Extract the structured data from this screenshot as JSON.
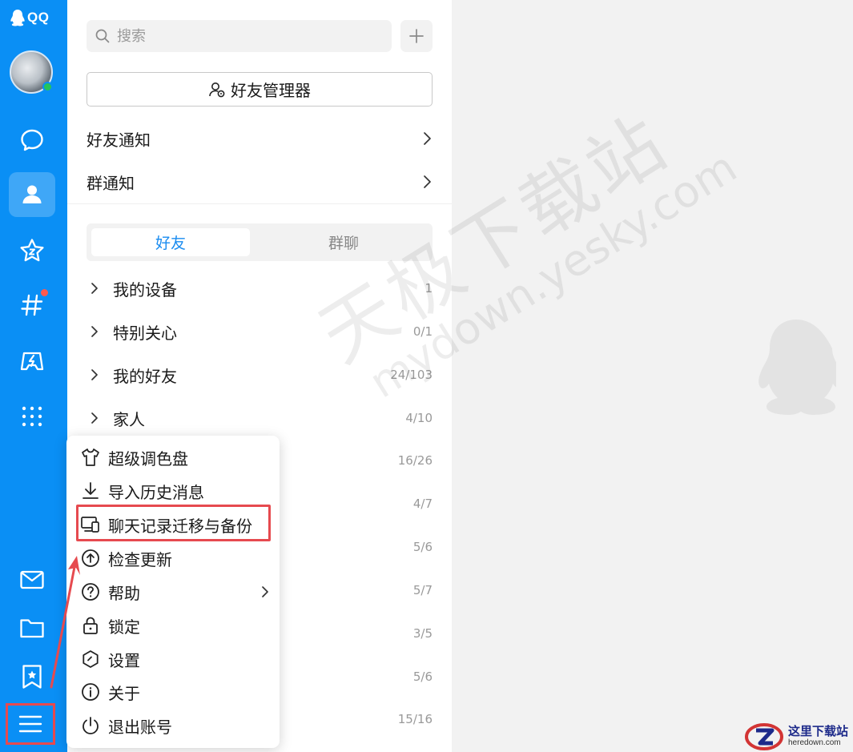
{
  "app": {
    "logo_text": "QQ"
  },
  "colors": {
    "rail_bg": "#0a8ff5",
    "accent": "#1a8cf0",
    "annotation_red": "#e64a4f",
    "online_green": "#25c45a",
    "badge_red": "#ff5a4e"
  },
  "rail": {
    "items": [
      {
        "id": "messages",
        "icon": "chat-bubble-icon"
      },
      {
        "id": "contacts",
        "icon": "person-icon",
        "active": true
      },
      {
        "id": "favorites",
        "icon": "star-icon"
      },
      {
        "id": "channels",
        "icon": "hashtag-icon",
        "badge": true
      },
      {
        "id": "games",
        "icon": "game-lightning-icon"
      },
      {
        "id": "apps",
        "icon": "grid-icon"
      }
    ],
    "bottom_items": [
      {
        "id": "mail",
        "icon": "mail-icon"
      },
      {
        "id": "files",
        "icon": "folder-icon"
      },
      {
        "id": "bookmarks",
        "icon": "bookmark-star-icon"
      },
      {
        "id": "main-menu",
        "icon": "hamburger-menu-icon"
      }
    ]
  },
  "search": {
    "placeholder": "搜索"
  },
  "friend_manager": {
    "label": "好友管理器"
  },
  "notices": [
    {
      "label": "好友通知"
    },
    {
      "label": "群通知"
    }
  ],
  "tabs": [
    {
      "label": "好友",
      "active": true
    },
    {
      "label": "群聊",
      "active": false
    }
  ],
  "groups": [
    {
      "name": "我的设备",
      "count": "1"
    },
    {
      "name": "特别关心",
      "count": "0/1"
    },
    {
      "name": "我的好友",
      "count": "24/103"
    },
    {
      "name": "家人",
      "count": "4/10"
    }
  ],
  "hidden_group_counts": [
    "16/26",
    "4/7",
    "5/6",
    "5/7",
    "3/5",
    "5/6",
    "15/16"
  ],
  "menu": {
    "items": [
      {
        "label": "超级调色盘",
        "icon": "tshirt-icon"
      },
      {
        "label": "导入历史消息",
        "icon": "download-icon"
      },
      {
        "label": "聊天记录迁移与备份",
        "icon": "devices-icon",
        "highlighted": true
      },
      {
        "label": "检查更新",
        "icon": "upload-circle-icon"
      },
      {
        "label": "帮助",
        "icon": "help-circle-icon",
        "has_submenu": true
      },
      {
        "label": "锁定",
        "icon": "lock-icon"
      },
      {
        "label": "设置",
        "icon": "settings-hexagon-icon"
      },
      {
        "label": "关于",
        "icon": "info-circle-icon"
      },
      {
        "label": "退出账号",
        "icon": "power-icon"
      }
    ]
  },
  "watermark": {
    "line1": "天极下载站",
    "line2": "mydown.yesky.com"
  },
  "corner_logo": {
    "main": "这里下载站",
    "sub": "heredown.com"
  }
}
